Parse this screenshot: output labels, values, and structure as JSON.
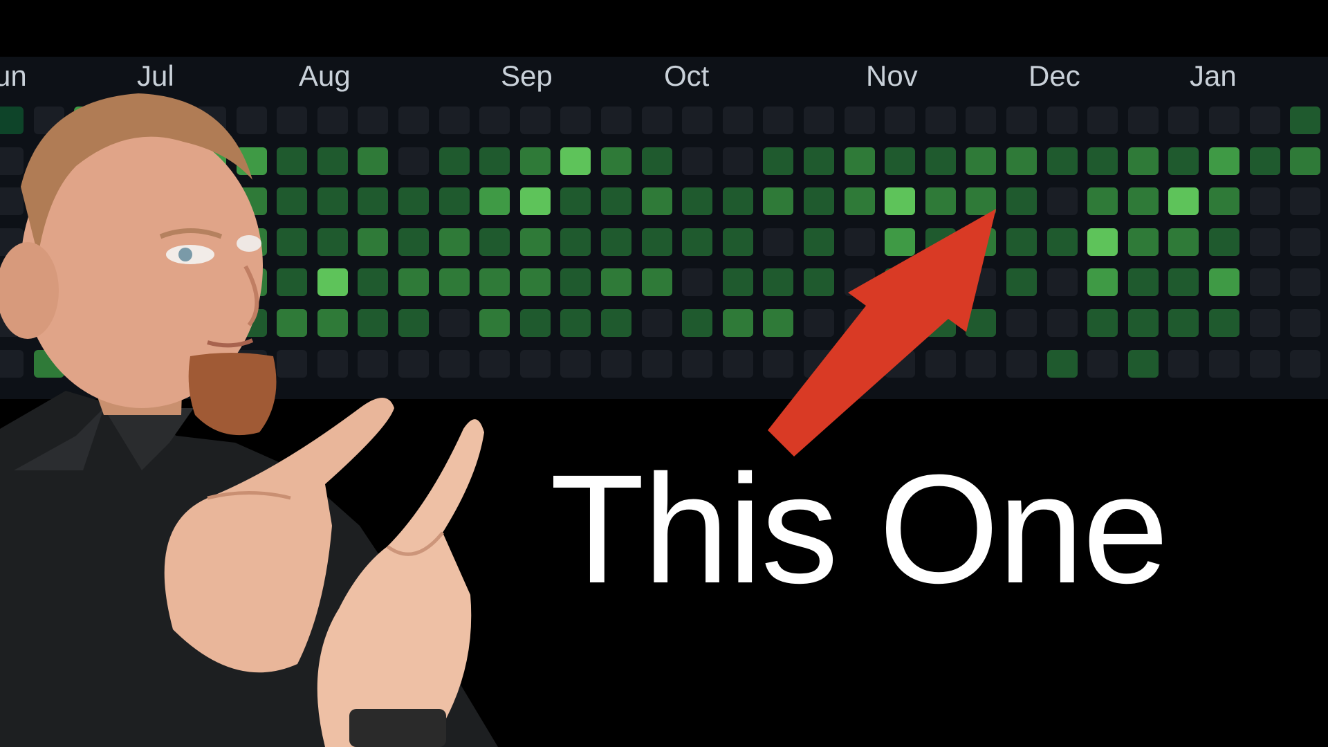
{
  "headline": "This One",
  "months": [
    "un",
    "Jul",
    "Aug",
    "Sep",
    "Oct",
    "Nov",
    "Dec",
    "Jan"
  ],
  "colors": {
    "background": "#000000",
    "panel": "#0d1117",
    "empty": "#1a1e25",
    "level1": "#0e4429",
    "level2": "#1f5a2e",
    "level3": "#2f7a38",
    "level4": "#3f9a45",
    "level5": "#5ec35a",
    "arrow": "#d93a25",
    "headline": "#ffffff"
  },
  "contribution_levels": [
    [
      1,
      0,
      4,
      0,
      0,
      0,
      0,
      0,
      0,
      0,
      0,
      0,
      0,
      0,
      0,
      0,
      0,
      0,
      0,
      0,
      0,
      0,
      0,
      0,
      0,
      0,
      0,
      0,
      0,
      0,
      0,
      0,
      2
    ],
    [
      0,
      0,
      2,
      5,
      2,
      4,
      4,
      2,
      2,
      3,
      0,
      2,
      2,
      3,
      5,
      3,
      2,
      0,
      0,
      2,
      2,
      3,
      2,
      2,
      3,
      3,
      2,
      2,
      3,
      2,
      4,
      2,
      3
    ],
    [
      0,
      0,
      0,
      2,
      4,
      0,
      3,
      2,
      2,
      2,
      2,
      2,
      4,
      5,
      2,
      2,
      3,
      2,
      2,
      3,
      2,
      3,
      5,
      3,
      3,
      2,
      0,
      3,
      3,
      5,
      3,
      0,
      0
    ],
    [
      0,
      0,
      0,
      2,
      3,
      2,
      3,
      2,
      2,
      3,
      2,
      3,
      2,
      3,
      2,
      2,
      2,
      2,
      2,
      0,
      2,
      0,
      4,
      2,
      3,
      2,
      2,
      5,
      3,
      3,
      2,
      0,
      0
    ],
    [
      0,
      0,
      0,
      2,
      4,
      2,
      3,
      2,
      5,
      2,
      3,
      3,
      3,
      3,
      2,
      3,
      3,
      0,
      2,
      2,
      2,
      0,
      2,
      2,
      0,
      2,
      0,
      4,
      2,
      2,
      4,
      0,
      0
    ],
    [
      0,
      0,
      0,
      3,
      2,
      2,
      2,
      3,
      3,
      2,
      2,
      0,
      3,
      2,
      2,
      2,
      0,
      2,
      3,
      3,
      0,
      0,
      2,
      2,
      2,
      0,
      0,
      2,
      2,
      2,
      2,
      0,
      0
    ],
    [
      0,
      3,
      0,
      0,
      0,
      0,
      0,
      0,
      0,
      0,
      0,
      0,
      0,
      0,
      0,
      0,
      0,
      0,
      0,
      0,
      0,
      0,
      0,
      0,
      0,
      0,
      2,
      0,
      2,
      0,
      0,
      0,
      0
    ]
  ]
}
